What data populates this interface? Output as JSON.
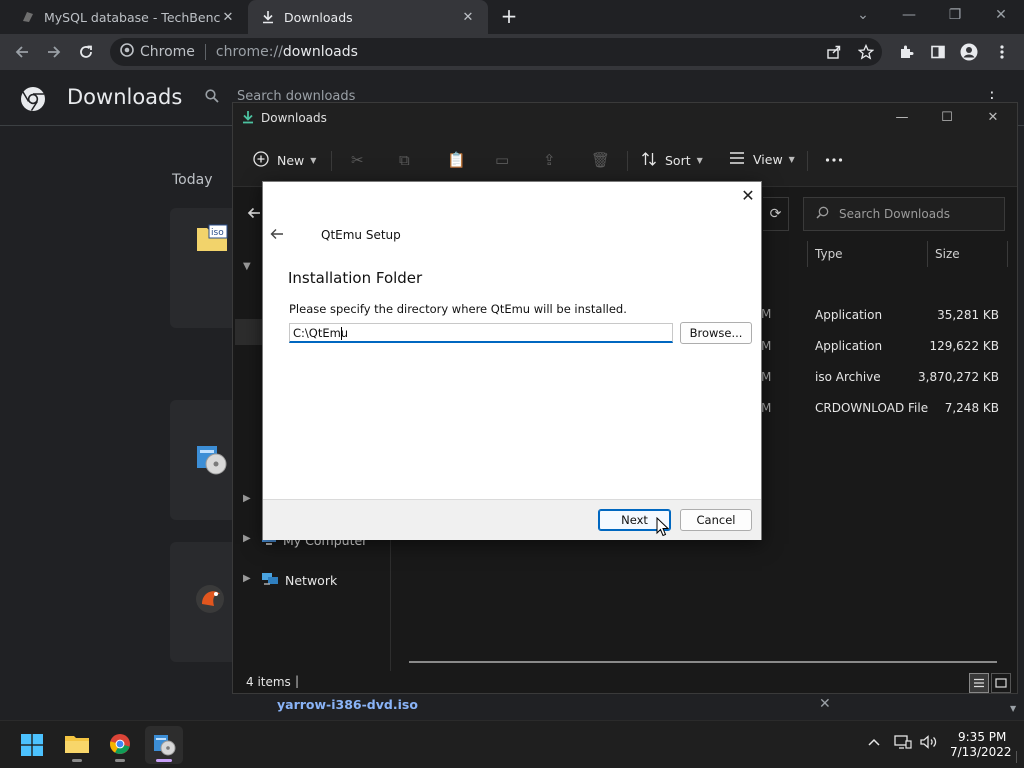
{
  "browser": {
    "tabs": [
      {
        "title": "MySQL database - TechBench by",
        "close": "✕"
      },
      {
        "title": "Downloads",
        "close": "✕"
      }
    ],
    "new_tab": "+",
    "omnibox": {
      "chip": "Chrome",
      "scheme": "chrome://",
      "host": "downloads"
    }
  },
  "downloads_page": {
    "title": "Downloads",
    "search_placeholder": "Search downloads",
    "section": "Today",
    "bottom_file": "yarrow-i386-dvd.iso"
  },
  "explorer": {
    "title": "Downloads",
    "commands": {
      "new": "New",
      "sort": "Sort",
      "view": "View"
    },
    "search_placeholder": "Search Downloads",
    "columns": {
      "type": "Type",
      "size": "Size"
    },
    "rows": [
      {
        "frag": "M",
        "type": "Application",
        "size": "35,281 KB"
      },
      {
        "frag": "M",
        "type": "Application",
        "size": "129,622 KB"
      },
      {
        "frag": "M",
        "type": "iso Archive",
        "size": "3,870,272 KB"
      },
      {
        "frag": "M",
        "type": "CRDOWNLOAD File",
        "size": "7,248 KB"
      }
    ],
    "nav": {
      "my_computer": "My Computer",
      "network": "Network"
    },
    "status_count": "4 items"
  },
  "dialog": {
    "app_name": "QtEmu Setup",
    "heading": "Installation Folder",
    "description": "Please specify the directory where QtEmu will be installed.",
    "path_value": "C:\\QtEmu",
    "browse_label": "Browse...",
    "next_label": "Next",
    "cancel_label": "Cancel"
  },
  "taskbar": {
    "time": "9:35 PM",
    "date": "7/13/2022"
  },
  "colors": {
    "accent": "#0067c0",
    "chrome_bg": "#202124",
    "link": "#8ab4f8"
  }
}
